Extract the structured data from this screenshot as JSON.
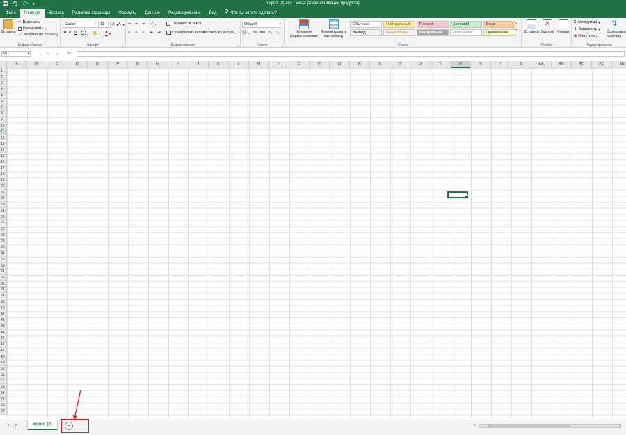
{
  "title": "export (3).csv - Excel (Сбой активации продукта)",
  "tabs": [
    "Файл",
    "Главная",
    "Вставка",
    "Разметка страницы",
    "Формулы",
    "Данные",
    "Рецензирование",
    "Вид"
  ],
  "tell_me": "Что вы хотите сделать?",
  "ribbon": {
    "clipboard": {
      "paste": "Вставить",
      "cut": "Вырезать",
      "copy": "Копировать",
      "format_painter": "Формат по образцу",
      "label": "Буфер обмена"
    },
    "font": {
      "name": "Calibri",
      "size": "11",
      "bold": "Ж",
      "italic": "К",
      "underline": "Ч",
      "label": "Шрифт"
    },
    "alignment": {
      "wrap_text": "Перенести текст",
      "merge_center": "Объединить и поместить в центре",
      "label": "Выравнивание"
    },
    "number": {
      "format": "Общий",
      "percent": "%",
      "thousands": "000",
      "label": "Число"
    },
    "conditional": "Условное форматирование",
    "format_table": "Форматировать как таблицу",
    "styles": {
      "row1": [
        "Обычный",
        "Нейтральный",
        "Плохой",
        "Хороший",
        "Ввод"
      ],
      "row2": [
        "Вывод",
        "Вычисление",
        "Контрольна...",
        "Пояснение",
        "Примечание"
      ],
      "label": "Стили"
    },
    "cells": {
      "insert": "Вставить",
      "delete": "Удалить",
      "format": "Формат",
      "label": "Ячейки"
    },
    "editing": {
      "autosum": "Автосумма",
      "fill": "Заполнить",
      "clear": "Очистить",
      "sort_filter": "Сортировка и фильтр",
      "label": "Редактирование"
    }
  },
  "formula_bar": {
    "name_box": "W11",
    "fx": "fx",
    "value": ""
  },
  "columns": [
    "A",
    "B",
    "C",
    "D",
    "E",
    "F",
    "G",
    "H",
    "I",
    "J",
    "K",
    "L",
    "M",
    "N",
    "O",
    "P",
    "Q",
    "R",
    "S",
    "T",
    "U",
    "V",
    "W",
    "X",
    "Y",
    "Z",
    "AA",
    "AB",
    "AC",
    "AD",
    "AE"
  ],
  "active_column": "W",
  "active_row": 11,
  "row_count": 57,
  "sheet_tabs": [
    "export (3)"
  ],
  "add_sheet": "+",
  "colors": {
    "excel_green": "#217346",
    "highlight_red": "#e02020"
  }
}
